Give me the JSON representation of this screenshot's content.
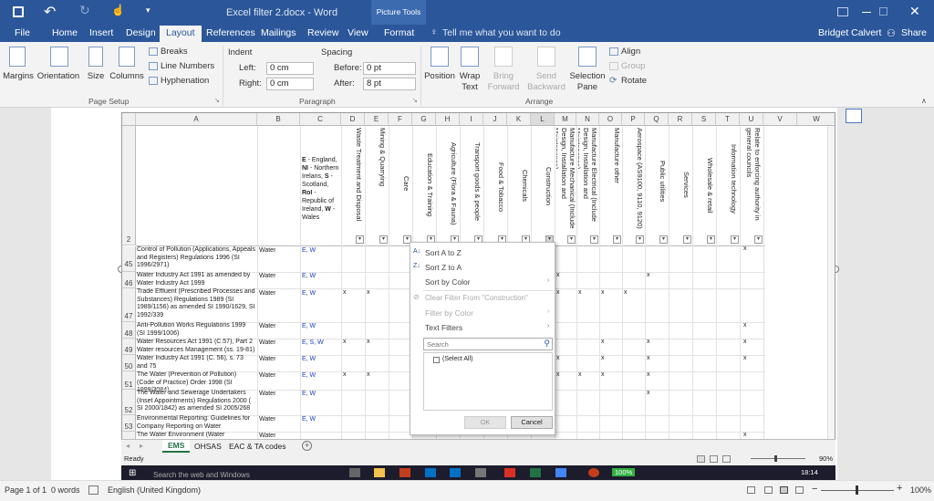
{
  "window": {
    "title": "Excel filter 2.docx - Word",
    "context_tab_group": "Picture Tools"
  },
  "tabs": [
    "File",
    "Home",
    "Insert",
    "Design",
    "Layout",
    "References",
    "Mailings",
    "Review",
    "View",
    "Format"
  ],
  "active_tab": "Layout",
  "tell_me": "Tell me what you want to do",
  "user": "Bridget Calvert",
  "share": "Share",
  "ribbon": {
    "margins": "Margins",
    "orientation": "Orientation",
    "size": "Size",
    "columns": "Columns",
    "breaks": "Breaks",
    "line_numbers": "Line Numbers",
    "hyphenation": "Hyphenation",
    "page_setup": "Page Setup",
    "indent": "Indent",
    "left_label": "Left:",
    "left_value": "0 cm",
    "right_label": "Right:",
    "right_value": "0 cm",
    "spacing": "Spacing",
    "before_label": "Before:",
    "before_value": "0 pt",
    "after_label": "After:",
    "after_value": "8 pt",
    "paragraph": "Paragraph",
    "position": "Position",
    "wrap_text_1": "Wrap",
    "wrap_text_2": "Text",
    "bring_forward_1": "Bring",
    "bring_forward_2": "Forward",
    "send_backward_1": "Send",
    "send_backward_2": "Backward",
    "selection_pane_1": "Selection",
    "selection_pane_2": "Pane",
    "align": "Align",
    "group": "Group",
    "rotate": "Rotate",
    "arrange": "Arrange"
  },
  "sheet": {
    "columns": [
      "A",
      "B",
      "C",
      "D",
      "E",
      "F",
      "G",
      "H",
      "I",
      "J",
      "K",
      "L",
      "M",
      "N",
      "O",
      "P",
      "Q",
      "R",
      "S",
      "T",
      "U",
      "V",
      "W"
    ],
    "header_row_num": "2",
    "c_header_bold_1": "E",
    "c_header_text_1": " - England, ",
    "c_header_bold_2": "NI",
    "c_header_text_2": " - Northern Irelans, ",
    "c_header_bold_3": "S",
    "c_header_text_3": " - Scotland, ",
    "c_header_bold_4": "RoI",
    "c_header_text_4": " - Republic of Ireland, ",
    "c_header_bold_5": "W",
    "c_header_text_5": " - Wales",
    "vertical_headers": [
      "Waste Treatment and Disposal",
      "Mining & Quarrying",
      "Care",
      "Education & Training",
      "Agriculture (Flora & Fauna)",
      "Transport goods & people",
      "Food & Tobacco",
      "Chemicals",
      "Construction",
      "Manufacture Mechanical (Include Design, Installation and Maintenance)",
      "Manufacture Electrical (Include Design, Installation and Maintenance)",
      "Manufacture other",
      "Aerospace (AS9100, 9110, 9120)",
      "Public utilities",
      "Services",
      "Wholesale & retail",
      "Information technology",
      "Relate to enforcing authority in general councils"
    ],
    "rows": [
      {
        "num": "45",
        "a": "Control of Pollution (Applications, Appeals and Registers) Regulations 1996 (SI 1996/2971)",
        "b": "Water",
        "c": "E, W"
      },
      {
        "num": "46",
        "a": "Water Industry Act 1991 as amended by Water Industry Act 1999",
        "b": "Water",
        "c": "E, W"
      },
      {
        "num": "47",
        "a": "Trade Effluent (Prescribed Processes and Substances) Regulations 1989 (SI 1989/1156) as amended SI 1990/1629, SI 1992/339",
        "b": "Water",
        "c": "E, W"
      },
      {
        "num": "48",
        "a": "Anti-Pollution Works Regulations 1999 (SI 1999/1006)",
        "b": "Water",
        "c": "E, W"
      },
      {
        "num": "49",
        "a": "Water Resources Act 1991 (C.57), Part 2 Water resources Management (ss. 19-81)",
        "b": "Water",
        "c": "E, S, W"
      },
      {
        "num": "50",
        "a": "Water Industry Act 1991 (C. 56), s. 73 and 75",
        "b": "Water",
        "c": "E, W"
      },
      {
        "num": "51",
        "a": "The Water (Prevention of Pollution) (Code of Practice) Order 1998 (SI 1998/3084)",
        "b": "Water",
        "c": "E, W"
      },
      {
        "num": "52",
        "a": "The Water and Sewerage Undertakers (Inset Appointments) Regulations 2000 ( SI 2000/1842) as amended SI 2005/268",
        "b": "Water",
        "c": "E, W"
      },
      {
        "num": "53",
        "a": "Environmental Reporting: Guidelines for Company Reporting on Water",
        "b": "Water",
        "c": "E, W"
      },
      {
        "num": "",
        "a": "The Water Environment (Water Framework",
        "b": "Water",
        "c": ""
      }
    ],
    "mark": "x",
    "sheet_tabs": [
      "EMS",
      "OHSAS",
      "EAC & TA codes"
    ],
    "ready": "Ready",
    "zoom": "90%"
  },
  "filter_menu": {
    "sort_az": "Sort A to Z",
    "sort_za": "Sort Z to A",
    "sort_color": "Sort by Color",
    "clear_filter": "Clear Filter From \"Construction\"",
    "filter_color": "Filter by Color",
    "text_filters": "Text Filters",
    "search_placeholder": "Search",
    "select_all": "(Select All)",
    "ok": "OK",
    "cancel": "Cancel"
  },
  "taskbar": {
    "search": "Search the web and Windows",
    "time": "18:14",
    "battery": "100%"
  },
  "status": {
    "page": "Page 1 of 1",
    "words": "0 words",
    "language": "English (United Kingdom)",
    "zoom": "100%"
  }
}
